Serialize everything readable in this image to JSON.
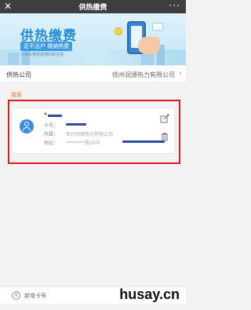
{
  "nav": {
    "title": "供热缴费",
    "close_glyph": "✕",
    "more_glyph": "···"
  },
  "banner": {
    "title": "供热缴费",
    "slogan": "足不出户  缴纳热费",
    "note": "让热水缴费便捷的新选择"
  },
  "company": {
    "label": "供热公司",
    "value": "徐州润源热力有限公司"
  },
  "section": {
    "label": "我家"
  },
  "card": {
    "name_prefix": "*",
    "fields": [
      {
        "key": "卡号：",
        "value": ""
      },
      {
        "key": "所属：",
        "value": "徐州润源热力有限公司"
      },
      {
        "key": "地址：",
        "value": "********路29号"
      }
    ]
  },
  "add_bar": {
    "label": "新增卡号"
  },
  "watermark": {
    "text": "husay.cn"
  },
  "colors": {
    "nav_bg": "#3f3f3f",
    "highlight": "#d81e1e",
    "section_label": "#e07a3c",
    "accent_blue": "#3d8be2"
  }
}
